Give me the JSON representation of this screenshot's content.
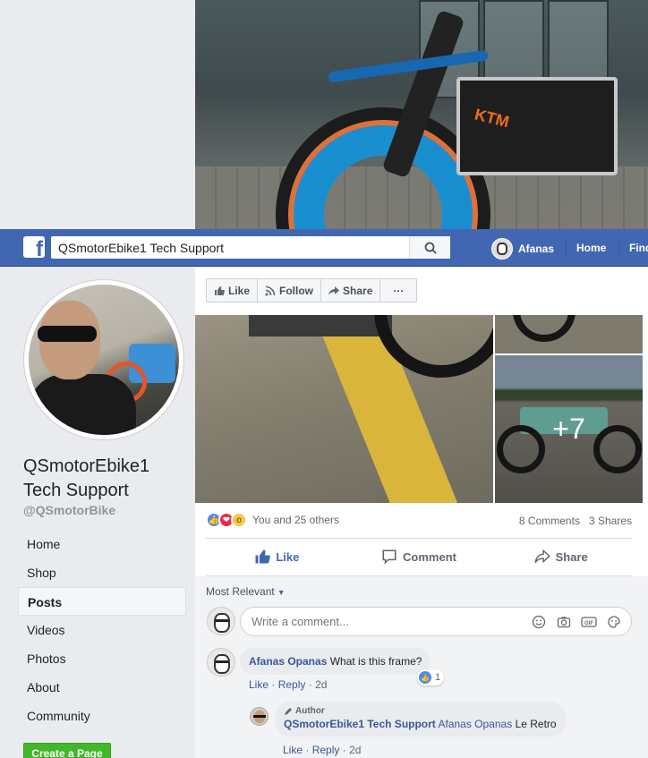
{
  "navbar": {
    "search_value": "QSmotorEbike1 Tech Support",
    "user_name": "Afanas",
    "home_label": "Home",
    "find_label": "Find"
  },
  "page": {
    "name": "QSmotorEbike1 Tech Support",
    "handle": "@QSmotorBike",
    "nav": [
      "Home",
      "Shop",
      "Posts",
      "Videos",
      "Photos",
      "About",
      "Community"
    ],
    "active_nav": "Posts",
    "create_page_label": "Create a Page"
  },
  "action_bar": {
    "like_label": "Like",
    "follow_label": "Follow",
    "share_label": "Share",
    "more_label": "···"
  },
  "post": {
    "more_photos": "+7",
    "reactions_text": "You and 25 others",
    "comments_count": "8 Comments",
    "shares_count": "3 Shares",
    "actions": {
      "like": "Like",
      "comment": "Comment",
      "share": "Share"
    }
  },
  "comments": {
    "sort_label": "Most Relevant",
    "write_placeholder": "Write a comment...",
    "items": [
      {
        "author": "Afanas Opanas",
        "text": "What is this frame?",
        "like": "Like",
        "reply": "Reply",
        "time": "2d",
        "likes": "1"
      }
    ],
    "reply": {
      "tag": "Author",
      "author": "QSmotorEbike1 Tech Support",
      "mention": "Afanas Opanas",
      "text": "Le Retro",
      "like": "Like",
      "reply": "Reply",
      "time": "2d"
    }
  },
  "colors": {
    "facebook_blue": "#4267b2",
    "link_blue": "#385898",
    "create_green": "#42b72a"
  }
}
